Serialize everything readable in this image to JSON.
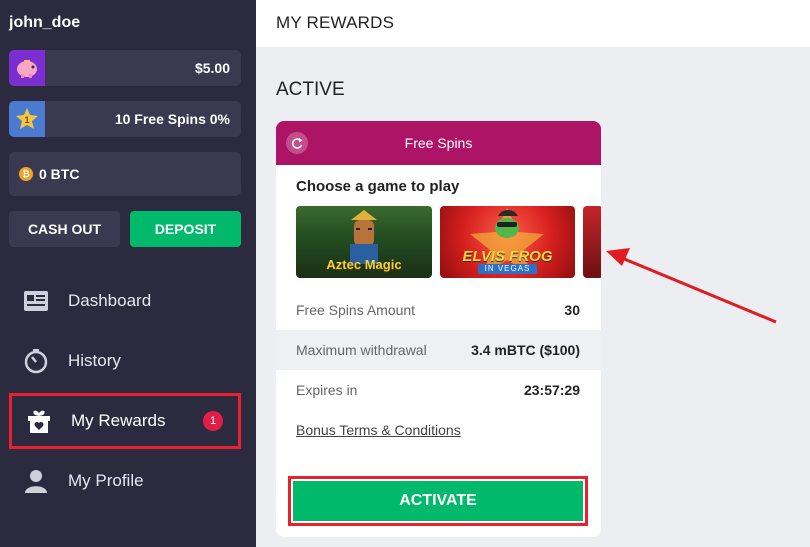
{
  "user": {
    "username": "john_doe"
  },
  "wallet": {
    "balance": "$5.00",
    "free_spins": "10 Free Spins 0%",
    "level_badge": "1",
    "btc": "0 BTC"
  },
  "actions": {
    "cashout_label": "CASH OUT",
    "deposit_label": "DEPOSIT"
  },
  "nav": {
    "items": [
      {
        "label": "Dashboard",
        "icon": "dashboard-icon"
      },
      {
        "label": "History",
        "icon": "history-icon"
      },
      {
        "label": "My Rewards",
        "icon": "gift-icon",
        "badge": "1",
        "active": true
      },
      {
        "label": "My Profile",
        "icon": "user-icon"
      }
    ]
  },
  "header": {
    "title": "MY REWARDS"
  },
  "section": {
    "title": "ACTIVE"
  },
  "reward": {
    "header": "Free Spins",
    "choose_label": "Choose a game to play",
    "games": [
      {
        "title": "Aztec Magic"
      },
      {
        "title": "ELVIS FROG",
        "subtitle": "IN VEGAS"
      }
    ],
    "details": [
      {
        "label": "Free Spins Amount",
        "value": "30"
      },
      {
        "label": "Maximum withdrawal",
        "value": "3.4 mBTC ($100)"
      },
      {
        "label": "Expires in",
        "value": "23:57:29"
      }
    ],
    "terms_label": "Bonus Terms & Conditions",
    "activate_label": "ACTIVATE"
  },
  "colors": {
    "sidebar_bg": "#2b2a3f",
    "accent_green": "#00b96b",
    "card_header": "#ae1466",
    "highlight_red": "#e8202f"
  }
}
